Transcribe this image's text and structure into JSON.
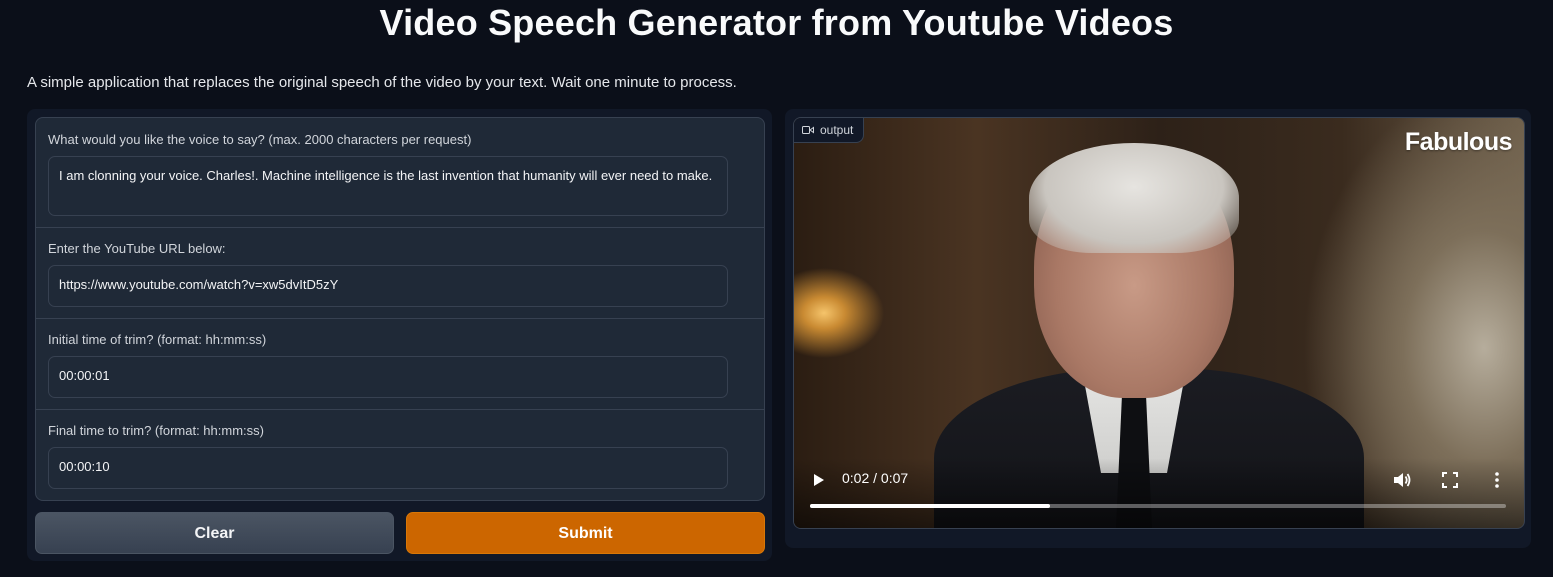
{
  "header": {
    "title": "Video Speech Generator from Youtube Videos",
    "description": "A simple application that replaces the original speech of the video by your text. Wait one minute to process."
  },
  "form": {
    "text_field": {
      "label": "What would you like the voice to say? (max. 2000 characters per request)",
      "value": "I am clonning your voice. Charles!. Machine intelligence is the last invention that humanity will ever need to make."
    },
    "url_field": {
      "label": "Enter the YouTube URL below:",
      "value": "https://www.youtube.com/watch?v=xw5dvItD5zY"
    },
    "start_field": {
      "label": "Initial time of trim? (format: hh:mm:ss)",
      "value": "00:00:01"
    },
    "end_field": {
      "label": "Final time to trim? (format: hh:mm:ss)",
      "value": "00:00:10"
    },
    "clear_label": "Clear",
    "submit_label": "Submit"
  },
  "output": {
    "tag_label": "output",
    "tag_icon": "video-camera-icon",
    "logo_text": "Fabulous",
    "time_display": "0:02 / 0:07",
    "progress_fraction": 0.345
  },
  "colors": {
    "background": "#0b0f19",
    "panel": "#111827",
    "field": "#1f2937",
    "border": "#374151",
    "submit": "#cc6600"
  }
}
